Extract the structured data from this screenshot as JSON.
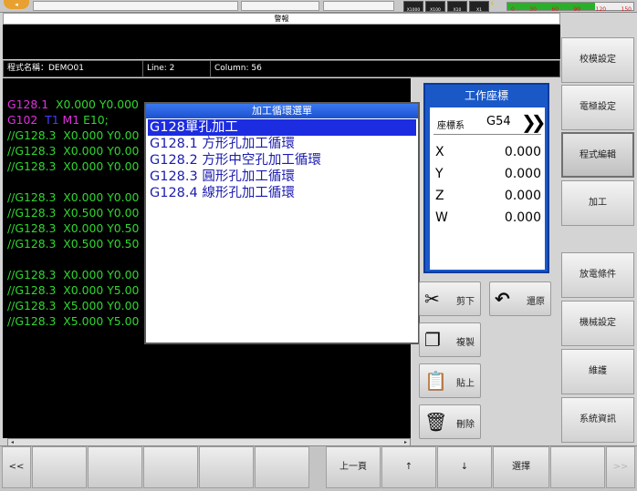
{
  "topbar": {
    "speed_labels": [
      "X1000",
      "X100",
      "X10",
      "X1"
    ],
    "meter_ticks": [
      "0",
      "30",
      "60",
      "90",
      "120",
      "150"
    ]
  },
  "alarm": {
    "title": "警報"
  },
  "program": {
    "name_label": "程式名稱：DEMO01",
    "line_label": "Line: 2",
    "column_label": "Column: 56"
  },
  "editor": {
    "lines": [
      {
        "parts": [
          [
            "mag",
            "G128.1"
          ],
          [
            "green",
            "  X0.000 Y0.000"
          ]
        ]
      },
      {
        "parts": [
          [
            "mag",
            "G102"
          ],
          [
            "blue",
            "  T1"
          ],
          [
            "mag",
            " M1"
          ],
          [
            "green",
            " E10;"
          ]
        ]
      },
      {
        "parts": [
          [
            "green",
            "//G128.3  X0.000 Y0.00"
          ]
        ]
      },
      {
        "parts": [
          [
            "green",
            "//G128.3  X0.000 Y0.00"
          ]
        ]
      },
      {
        "parts": [
          [
            "green",
            "//G128.3  X0.000 Y0.00"
          ]
        ]
      },
      {
        "parts": [
          [
            "green",
            ""
          ]
        ]
      },
      {
        "parts": [
          [
            "green",
            "//G128.3  X0.000 Y0.00"
          ]
        ]
      },
      {
        "parts": [
          [
            "green",
            "//G128.3  X0.500 Y0.00"
          ]
        ]
      },
      {
        "parts": [
          [
            "green",
            "//G128.3  X0.000 Y0.50"
          ]
        ]
      },
      {
        "parts": [
          [
            "green",
            "//G128.3  X0.500 Y0.50"
          ]
        ]
      },
      {
        "parts": [
          [
            "green",
            ""
          ]
        ]
      },
      {
        "parts": [
          [
            "green",
            "//G128.3  X0.000 Y0.00"
          ]
        ]
      },
      {
        "parts": [
          [
            "green",
            "//G128.3  X0.000 Y5.00"
          ]
        ]
      },
      {
        "parts": [
          [
            "green",
            "//G128.3  X5.000 Y0.00"
          ]
        ]
      },
      {
        "parts": [
          [
            "green",
            "//G128.3  X5.000 Y5.00"
          ]
        ]
      }
    ]
  },
  "popup": {
    "title": "加工循環選單",
    "items": [
      "G128單孔加工",
      "G128.1 方形孔加工循環",
      "G128.2 方形中空孔加工循環",
      "G128.3 圓形孔加工循環",
      "G128.4 線形孔加工循環"
    ],
    "selected_index": 0
  },
  "coord": {
    "title": "工作座標",
    "system_label": "座標系",
    "system_value": "G54",
    "axes": [
      {
        "name": "X",
        "value": "0.000"
      },
      {
        "name": "Y",
        "value": "0.000"
      },
      {
        "name": "Z",
        "value": "0.000"
      },
      {
        "name": "W",
        "value": "0.000"
      }
    ]
  },
  "edit_buttons": {
    "cut": "剪下",
    "undo": "還原",
    "copy": "複製",
    "paste": "貼上",
    "delete": "刪除"
  },
  "right_menu": [
    "校模設定",
    "電極設定",
    "程式編輯",
    "加工",
    "放電條件",
    "機械設定",
    "維護",
    "系統資訊"
  ],
  "right_menu_active": 2,
  "bottom": {
    "prev": "<<",
    "page_up": "上一頁",
    "up": "↑",
    "down": "↓",
    "select": "選擇",
    "next": ">>"
  },
  "colors": {
    "accent": "#1a58c8",
    "code_green": "#30d830",
    "code_magenta": "#e030e0"
  }
}
